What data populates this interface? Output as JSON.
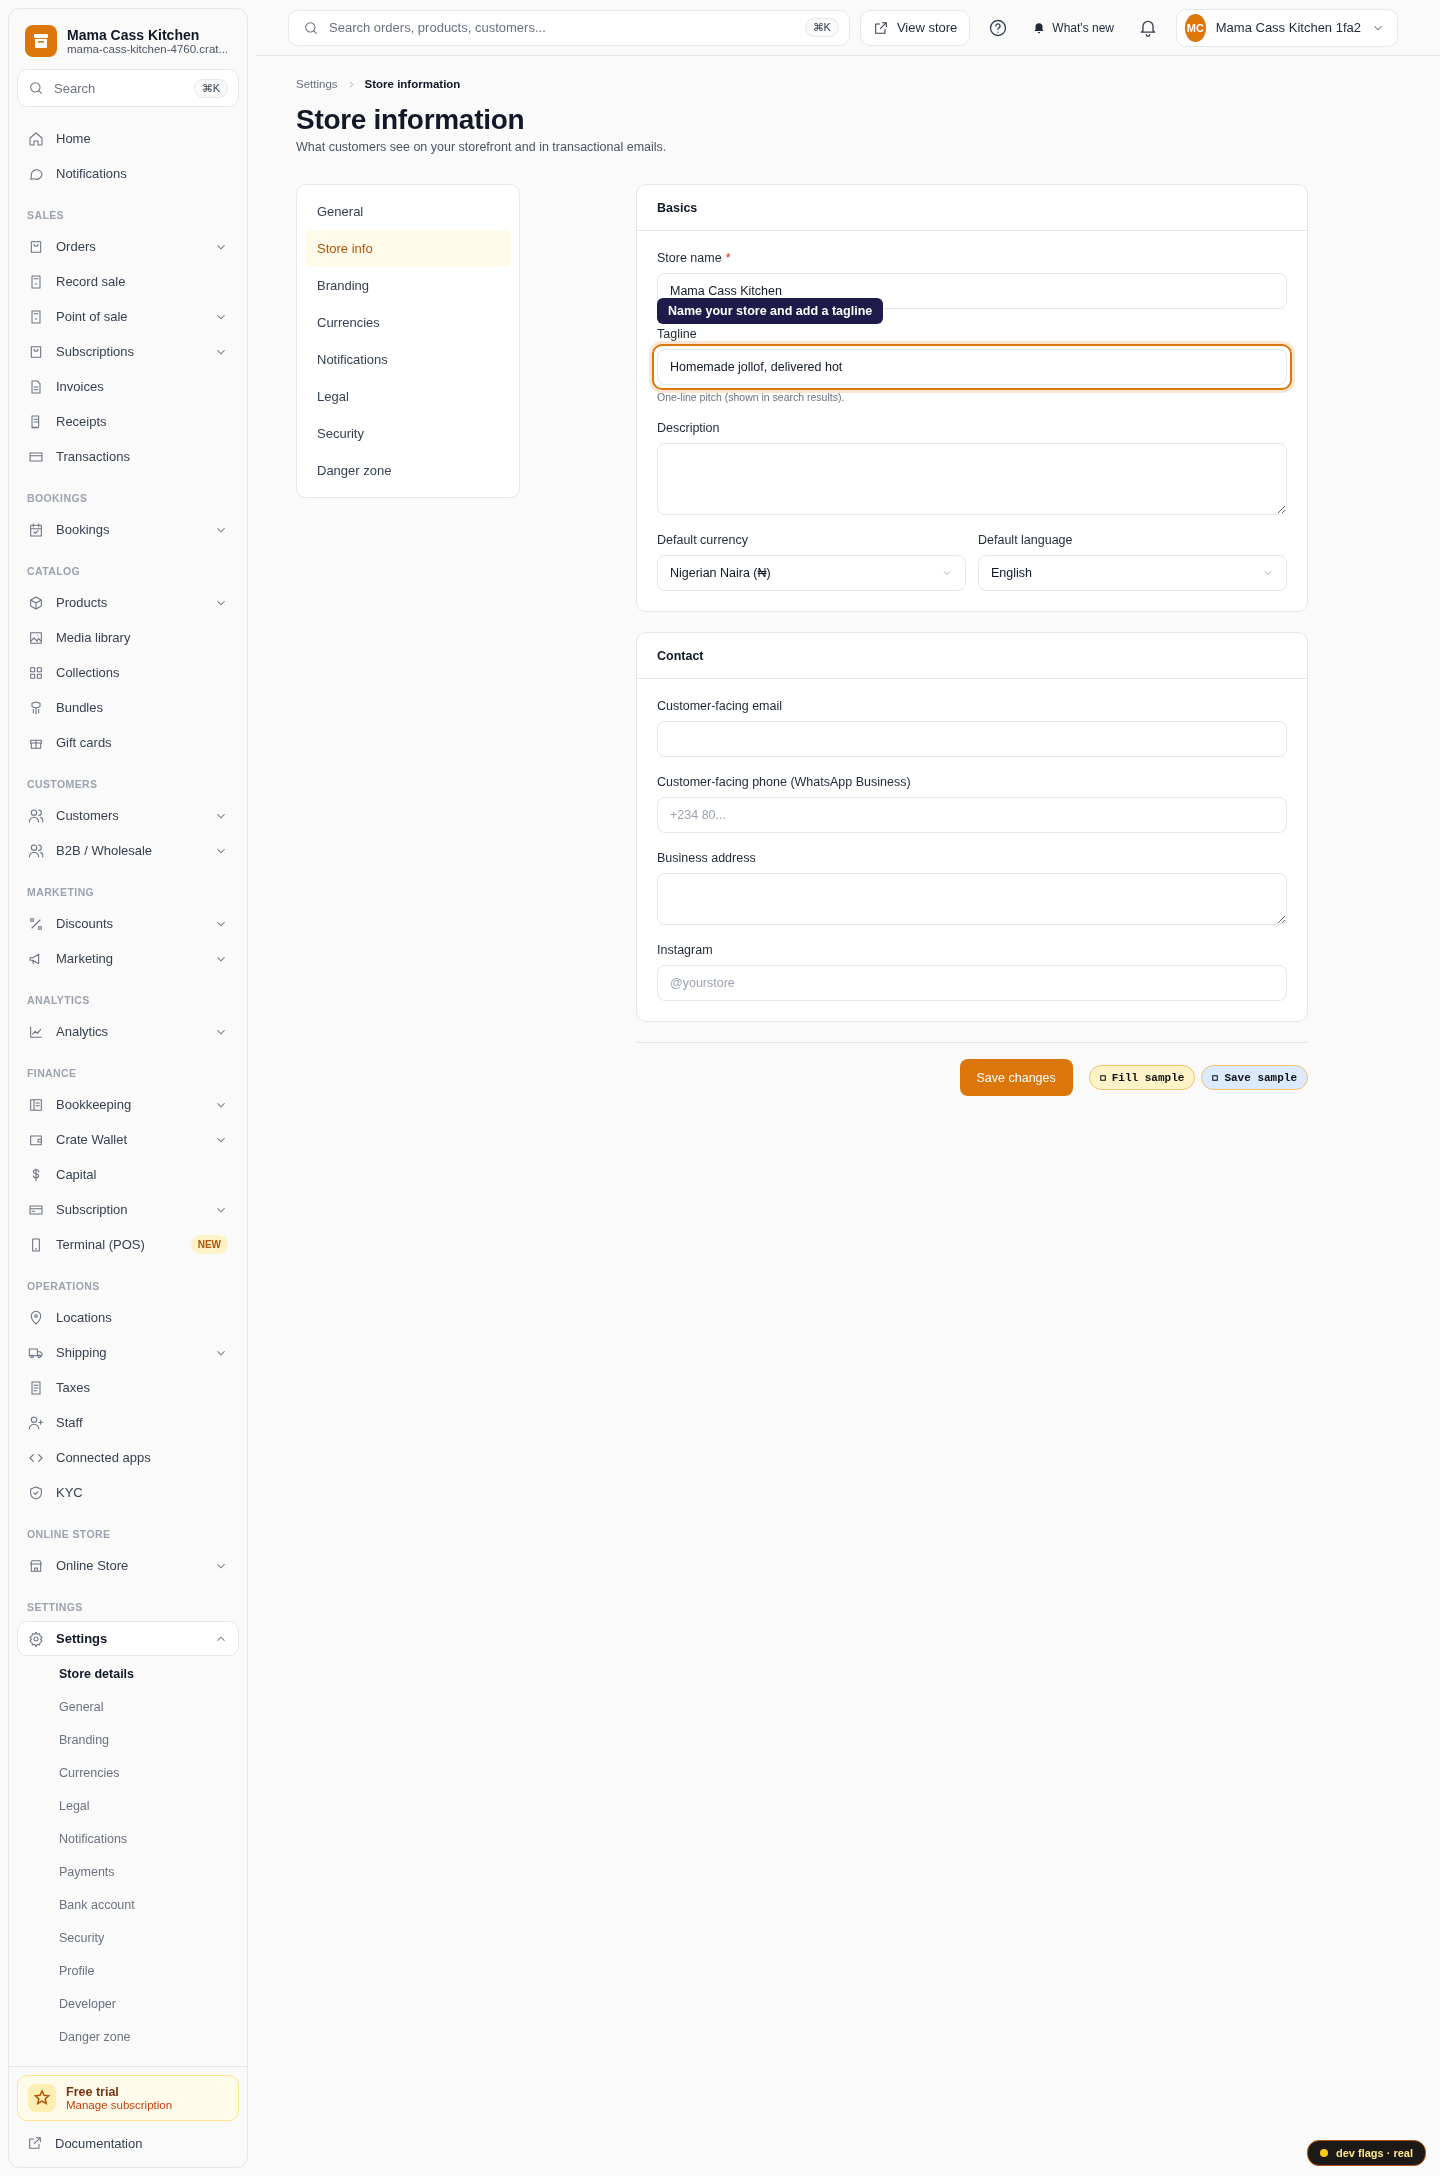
{
  "sidebar": {
    "store_name": "Mama Cass Kitchen",
    "store_url": "mama-cass-kitchen-4760.crat...",
    "search": {
      "placeholder": "Search",
      "shortcut": "⌘K"
    },
    "sections": [
      {
        "items": [
          {
            "label": "Home",
            "expandable": false,
            "selected": false
          },
          {
            "label": "Notifications",
            "expandable": false,
            "selected": false
          }
        ]
      },
      {
        "heading": "SALES",
        "items": [
          {
            "label": "Orders",
            "expandable": true,
            "expanded": false,
            "selected": false
          },
          {
            "label": "Record sale",
            "expandable": false,
            "selected": false
          },
          {
            "label": "Point of sale",
            "expandable": true,
            "expanded": false,
            "selected": false
          },
          {
            "label": "Subscriptions",
            "expandable": true,
            "expanded": false,
            "selected": false
          },
          {
            "label": "Invoices",
            "expandable": false,
            "selected": false
          },
          {
            "label": "Receipts",
            "expandable": false,
            "selected": false
          },
          {
            "label": "Transactions",
            "expandable": false,
            "selected": false
          }
        ]
      },
      {
        "heading": "BOOKINGS",
        "items": [
          {
            "label": "Bookings",
            "expandable": true,
            "expanded": false,
            "selected": false
          }
        ]
      },
      {
        "heading": "CATALOG",
        "items": [
          {
            "label": "Products",
            "expandable": true,
            "expanded": false,
            "selected": false
          },
          {
            "label": "Media library",
            "expandable": false,
            "selected": false
          },
          {
            "label": "Collections",
            "expandable": false,
            "selected": false
          },
          {
            "label": "Bundles",
            "expandable": false,
            "selected": false
          },
          {
            "label": "Gift cards",
            "expandable": false,
            "selected": false
          }
        ]
      },
      {
        "heading": "CUSTOMERS",
        "items": [
          {
            "label": "Customers",
            "expandable": true,
            "expanded": false,
            "selected": false
          },
          {
            "label": "B2B / Wholesale",
            "expandable": true,
            "expanded": false,
            "selected": false
          }
        ]
      },
      {
        "heading": "MARKETING",
        "items": [
          {
            "label": "Discounts",
            "expandable": true,
            "expanded": false,
            "selected": false
          },
          {
            "label": "Marketing",
            "expandable": true,
            "expanded": false,
            "selected": false
          }
        ]
      },
      {
        "heading": "ANALYTICS",
        "items": [
          {
            "label": "Analytics",
            "expandable": true,
            "expanded": false,
            "selected": false
          }
        ]
      },
      {
        "heading": "FINANCE",
        "items": [
          {
            "label": "Bookkeeping",
            "expandable": true,
            "expanded": false,
            "selected": false
          },
          {
            "label": "Crate Wallet",
            "expandable": true,
            "expanded": false,
            "selected": false
          },
          {
            "label": "Capital",
            "expandable": false,
            "selected": false
          },
          {
            "label": "Subscription",
            "expandable": true,
            "expanded": false,
            "selected": false
          },
          {
            "label": "Terminal (POS)",
            "expandable": false,
            "selected": false,
            "badge": "NEW"
          }
        ]
      },
      {
        "heading": "OPERATIONS",
        "items": [
          {
            "label": "Locations",
            "expandable": false,
            "selected": false
          },
          {
            "label": "Shipping",
            "expandable": true,
            "expanded": false,
            "selected": false
          },
          {
            "label": "Taxes",
            "expandable": false,
            "selected": false
          },
          {
            "label": "Staff",
            "expandable": false,
            "selected": false
          },
          {
            "label": "Connected apps",
            "expandable": false,
            "selected": false
          },
          {
            "label": "KYC",
            "expandable": false,
            "selected": false
          }
        ]
      },
      {
        "heading": "ONLINE STORE",
        "items": [
          {
            "label": "Online Store",
            "expandable": true,
            "expanded": false,
            "selected": false
          }
        ]
      },
      {
        "heading": "SETTINGS",
        "items": [
          {
            "label": "Settings",
            "expandable": true,
            "expanded": true,
            "selected": true,
            "children": [
              {
                "label": "Store details",
                "selected": true
              },
              {
                "label": "General",
                "selected": false
              },
              {
                "label": "Branding",
                "selected": false
              },
              {
                "label": "Currencies",
                "selected": false
              },
              {
                "label": "Legal",
                "selected": false
              },
              {
                "label": "Notifications",
                "selected": false
              },
              {
                "label": "Payments",
                "selected": false
              },
              {
                "label": "Bank account",
                "selected": false
              },
              {
                "label": "Security",
                "selected": false
              },
              {
                "label": "Profile",
                "selected": false
              },
              {
                "label": "Developer",
                "selected": false
              },
              {
                "label": "Danger zone",
                "selected": false
              }
            ]
          }
        ]
      }
    ],
    "trial": {
      "title": "Free trial",
      "link": "Manage subscription"
    },
    "documentation": "Documentation"
  },
  "topbar": {
    "search": {
      "placeholder": "Search orders, products, customers...",
      "shortcut": "⌘K"
    },
    "view_store": "View store",
    "whats_new": "What's new",
    "account": {
      "initials": "MC",
      "name": "Mama Cass Kitchen 1fa2"
    }
  },
  "breadcrumb": [
    "Settings",
    "Store information"
  ],
  "title": "Store information",
  "subtitle": "What customers see on your storefront and in transactional emails.",
  "settings_nav": [
    {
      "label": "General",
      "selected": false
    },
    {
      "label": "Store info",
      "selected": true
    },
    {
      "label": "Branding",
      "selected": false
    },
    {
      "label": "Currencies",
      "selected": false
    },
    {
      "label": "Notifications",
      "selected": false
    },
    {
      "label": "Legal",
      "selected": false
    },
    {
      "label": "Security",
      "selected": false
    },
    {
      "label": "Danger zone",
      "selected": false
    }
  ],
  "cards": [
    {
      "title": "Basics",
      "fields": [
        {
          "kind": "input",
          "label": "Store name",
          "required_mark": "*",
          "value": "Mama Cass Kitchen",
          "focused": false
        },
        {
          "kind": "input",
          "label": "Tagline",
          "value": "Homemade jollof, delivered hot",
          "focused": true,
          "tooltip": "Name your store and add a tagline",
          "hint": "One-line pitch (shown in search results)."
        },
        {
          "kind": "textarea",
          "label": "Description",
          "focused": false
        },
        {
          "kind": "row",
          "fields": [
            {
              "kind": "select",
              "label": "Default currency",
              "value": "Nigerian Naira (₦)",
              "focused": false
            },
            {
              "kind": "select",
              "label": "Default language",
              "value": "English",
              "focused": false
            }
          ]
        }
      ]
    },
    {
      "title": "Contact",
      "fields": [
        {
          "kind": "input",
          "label": "Customer-facing email",
          "focused": false
        },
        {
          "kind": "input",
          "label": "Customer-facing phone (WhatsApp Business)",
          "placeholder": "+234 80...",
          "focused": false
        },
        {
          "kind": "textarea",
          "label": "Business address",
          "focused": false
        },
        {
          "kind": "input",
          "label": "Instagram",
          "placeholder": "@yourstore",
          "focused": false
        }
      ]
    }
  ],
  "actions": {
    "save": "Save changes",
    "samples": [
      {
        "label": "Fill sample",
        "color": "#fef3c7"
      },
      {
        "label": "Save sample",
        "color": "#dbeafe"
      }
    ]
  },
  "dev_badge": "dev flags · real"
}
